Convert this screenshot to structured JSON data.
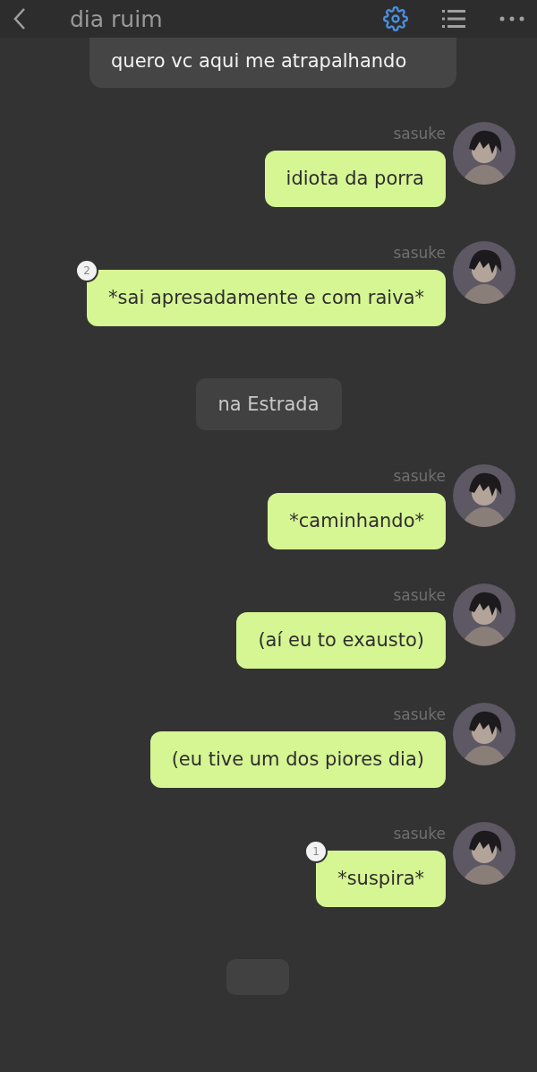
{
  "header": {
    "title": "dia ruim"
  },
  "messages": [
    {
      "kind": "incoming",
      "text": "quero vc aqui me atrapalhando"
    },
    {
      "kind": "outgoing",
      "author": "sasuke",
      "text": "idiota da porra"
    },
    {
      "kind": "outgoing",
      "author": "sasuke",
      "text": "*sai apresadamente e com raiva*",
      "badge": "2"
    },
    {
      "kind": "note",
      "text": "na Estrada"
    },
    {
      "kind": "outgoing",
      "author": "sasuke",
      "text": "*caminhando*"
    },
    {
      "kind": "outgoing",
      "author": "sasuke",
      "text": "(aí eu to exausto)"
    },
    {
      "kind": "outgoing",
      "author": "sasuke",
      "text": "(eu tive um dos piores dia)"
    },
    {
      "kind": "outgoing",
      "author": "sasuke",
      "text": "*suspira*",
      "badge": "1"
    },
    {
      "kind": "cut"
    }
  ]
}
